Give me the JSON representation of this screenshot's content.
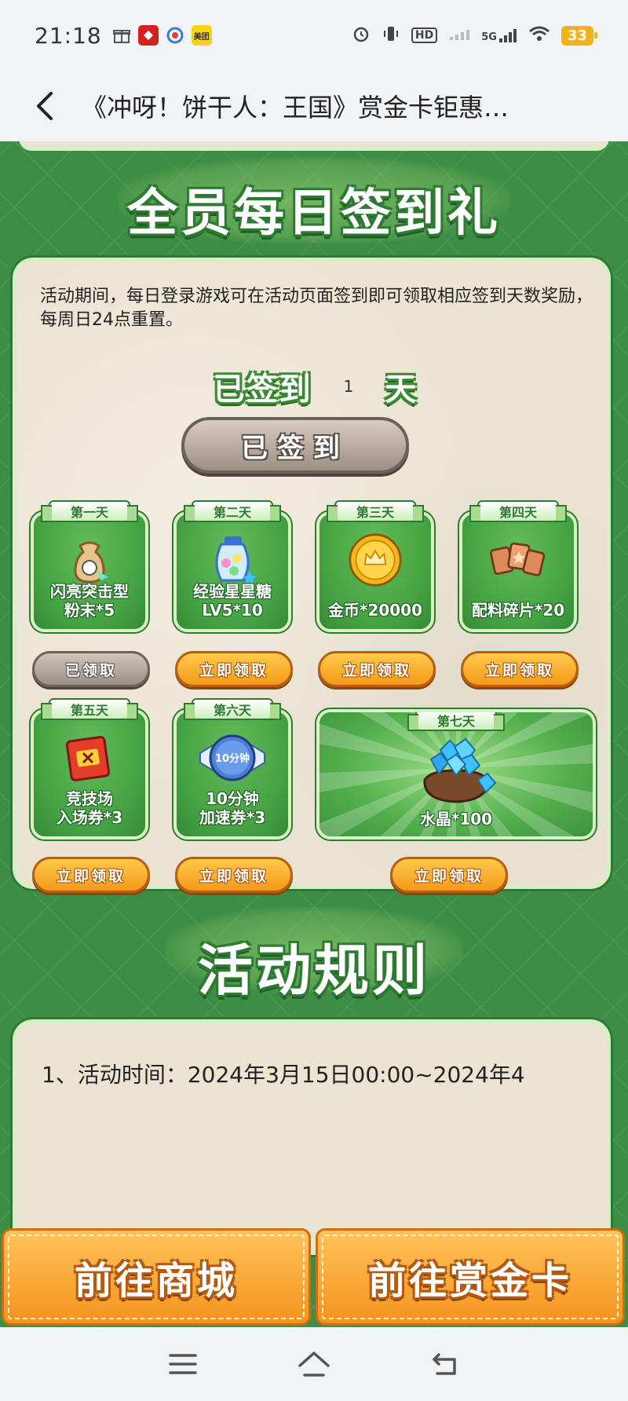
{
  "status_bar": {
    "time": "21:18",
    "app_icons": [
      "gift-icon",
      "news-app-icon",
      "browser-app-icon",
      "meituan-app-icon"
    ],
    "meituan_label": "美团",
    "hd_label": "HD",
    "network_label": "5G",
    "battery": "33"
  },
  "title_bar": {
    "title": "《冲呀！饼干人：王国》赏金卡钜惠…"
  },
  "checkin": {
    "banner_title": "全员每日签到礼",
    "description": "活动期间，每日登录游戏可在活动页面签到即可领取相应签到天数奖励，每周日24点重置。",
    "signed_prefix": "已签到",
    "signed_days": "1",
    "signed_suffix": "天",
    "signed_button": "已签到",
    "days": [
      {
        "day": "第一天",
        "reward": "闪亮突击型粉末*5",
        "reward_line1": "闪亮突击型",
        "reward_line2": "粉末*5",
        "button": "已领取",
        "claimed": true,
        "icon": "powder-bag-icon"
      },
      {
        "day": "第二天",
        "reward": "经验星星糖LV5*10",
        "reward_line1": "经验星星糖",
        "reward_line2": "LV5*10",
        "button": "立即领取",
        "claimed": false,
        "icon": "star-candy-icon"
      },
      {
        "day": "第三天",
        "reward": "金币*20000",
        "reward_line1": "",
        "reward_line2": "金币*20000",
        "button": "立即领取",
        "claimed": false,
        "icon": "gold-coin-icon"
      },
      {
        "day": "第四天",
        "reward": "配料碎片*20",
        "reward_line1": "",
        "reward_line2": "配料碎片*20",
        "button": "立即领取",
        "claimed": false,
        "icon": "topping-shards-icon"
      },
      {
        "day": "第五天",
        "reward": "竞技场入场券*3",
        "reward_line1": "竞技场",
        "reward_line2": "入场券*3",
        "button": "立即领取",
        "claimed": false,
        "icon": "arena-ticket-icon"
      },
      {
        "day": "第六天",
        "reward": "10分钟加速券*3",
        "reward_line1": "10分钟",
        "reward_line2": "加速券*3",
        "button": "立即领取",
        "claimed": false,
        "icon": "speedup-ticket-icon",
        "icon_text": "10分钟"
      },
      {
        "day": "第七天",
        "reward": "水晶*100",
        "reward_line1": "",
        "reward_line2": "水晶*100",
        "button": "立即领取",
        "claimed": false,
        "icon": "crystal-bag-icon"
      }
    ]
  },
  "rules": {
    "banner_title": "活动规则",
    "line1": "1、活动时间：2024年3月15日00:00~2024年4"
  },
  "bottom_buttons": {
    "shop": "前往商城",
    "bounty_card": "前往赏金卡"
  },
  "nav": {
    "menu": "menu-icon",
    "home": "home-icon",
    "back": "back-nav-icon"
  },
  "colors": {
    "page_green": "#3e8d45",
    "card_beige": "#ece4d3",
    "button_orange": "#f59a1a",
    "button_grey": "#9a8f86"
  }
}
